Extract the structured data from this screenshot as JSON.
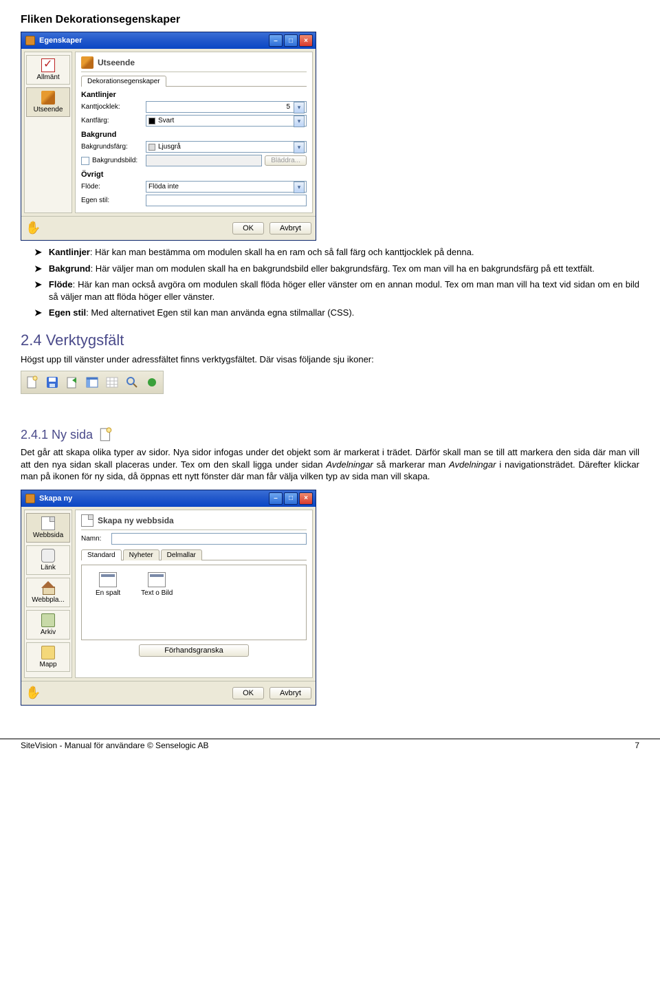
{
  "headings": {
    "flik": "Fliken Dekorationsegenskaper",
    "verktygsfalt": "2.4 Verktygsfält",
    "nysida": "2.4.1 Ny sida"
  },
  "dialog1": {
    "title": "Egenskaper",
    "sidebar": {
      "allmant": "Allmänt",
      "utseende": "Utseende"
    },
    "panelTitle": "Utseende",
    "tab": "Dekorationsegenskaper",
    "groups": {
      "kantlinjer": "Kantlinjer",
      "bakgrund": "Bakgrund",
      "ovrigt": "Övrigt"
    },
    "labels": {
      "kanttjocklek": "Kanttjocklek:",
      "kantfarg": "Kantfärg:",
      "bakgrundsfarg": "Bakgrundsfärg:",
      "bakgrundsbild": "Bakgrundsbild:",
      "flode": "Flöde:",
      "egenstil": "Egen stil:"
    },
    "values": {
      "kanttjocklek": "5",
      "kantfarg": "Svart",
      "bakgrundsfarg": "Ljusgrå",
      "flode": "Flöda inte"
    },
    "browse": "Bläddra...",
    "ok": "OK",
    "cancel": "Avbryt"
  },
  "bullets": {
    "b1": {
      "lead": "Kantlinjer",
      "text": ": Här kan man bestämma om modulen skall ha en ram och så fall färg och kanttjocklek på denna."
    },
    "b2": {
      "lead": "Bakgrund",
      "text": ": Här väljer man om modulen skall ha en bakgrundsbild eller bakgrundsfärg. Tex om man vill ha en bakgrundsfärg på ett textfält."
    },
    "b3": {
      "lead": "Flöde",
      "text": ": Här kan man också avgöra om modulen skall flöda höger eller vänster om en annan modul. Tex om man man vill ha text vid sidan om en bild så väljer man att flöda höger eller vänster."
    },
    "b4": {
      "lead": "Egen stil",
      "text": ": Med alternativet Egen stil kan man använda egna stilmallar (CSS)."
    }
  },
  "text": {
    "verktyg_intro": "Högst upp till vänster under adressfältet finns verktygsfältet. Där visas följande sju ikoner:",
    "nysida_para": "Det går att skapa olika typer av sidor. Nya sidor infogas under det objekt som är markerat i trädet. Därför skall man se till att markera den sida där man vill att den nya sidan skall placeras under. Tex om den skall ligga under sidan Avdelningar så markerar man Avdelningar i navigationsträdet. Därefter klickar man på ikonen för ny sida, då öppnas ett nytt fönster där man får välja vilken typ av sida man vill skapa.",
    "italic1": "Avdelningar",
    "italic2": "Avdelningar"
  },
  "dialog2": {
    "title": "Skapa ny",
    "sidebar": {
      "webbsida": "Webbsida",
      "lank": "Länk",
      "webbpla": "Webbpla...",
      "arkiv": "Arkiv",
      "mapp": "Mapp"
    },
    "panelTitle": "Skapa ny webbsida",
    "nameLabel": "Namn:",
    "tabs": {
      "standard": "Standard",
      "nyheter": "Nyheter",
      "delmallar": "Delmallar"
    },
    "templates": {
      "enspalt": "En spalt",
      "textobild": "Text o Bild"
    },
    "preview": "Förhandsgranska",
    "ok": "OK",
    "cancel": "Avbryt"
  },
  "footer": {
    "left": "SiteVision - Manual för användare © Senselogic AB",
    "right": "7"
  }
}
